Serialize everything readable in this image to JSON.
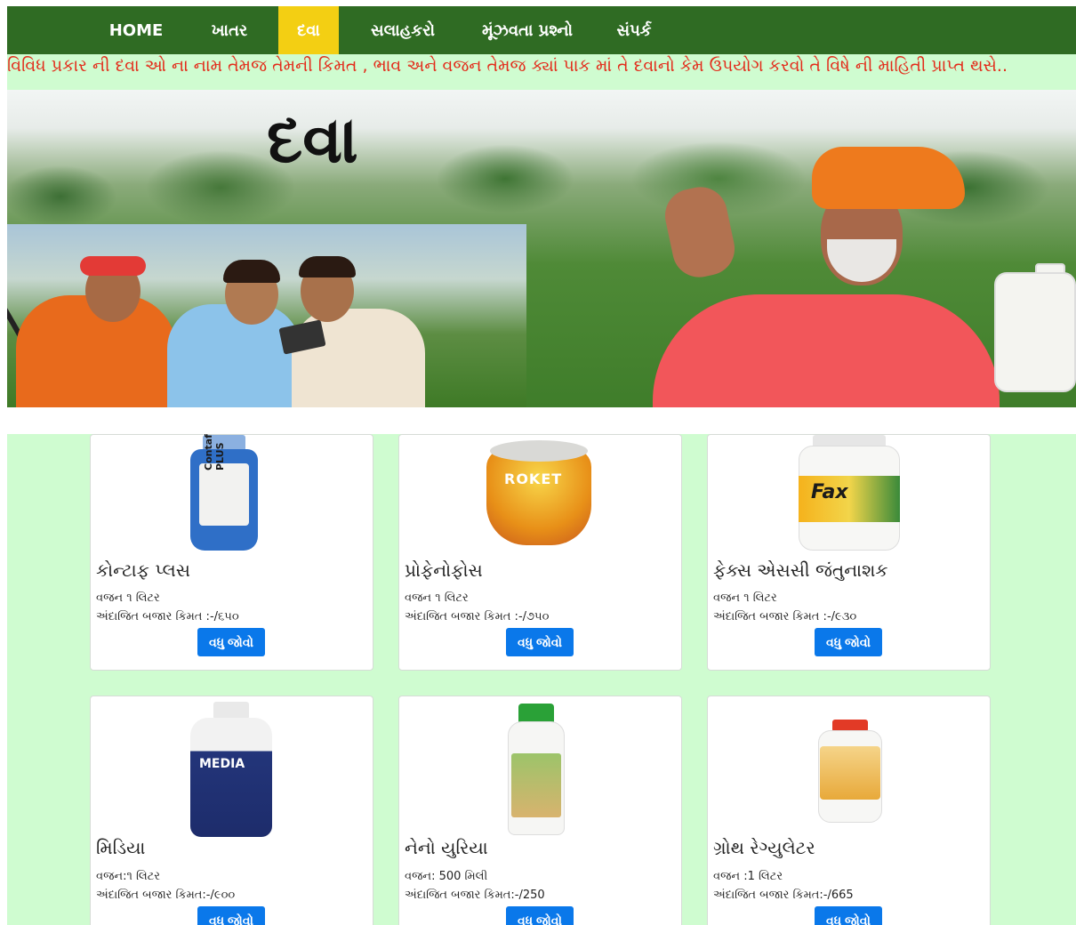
{
  "nav": {
    "items": [
      {
        "label": "HOME",
        "active": false
      },
      {
        "label": "ખાતર",
        "active": false
      },
      {
        "label": "દવા",
        "active": true
      },
      {
        "label": "સલાહકરો",
        "active": false
      },
      {
        "label": "મૂંઝવતા પ્રશ્નો",
        "active": false
      },
      {
        "label": "સંપર્ક",
        "active": false
      }
    ]
  },
  "marquee": {
    "text": "વિવિધ પ્રકાર ની દવા ઓ ના નામ તેમજ તેમની કિમત , ભાવ અને વજન તેમજ ક્યાં પાક માં તે દવાનો કેમ ઉપયોગ કરવો તે વિષે ની માહિતી પ્રાપ્ત થસે.."
  },
  "banner": {
    "title": "દવા"
  },
  "products": [
    {
      "name": "કોન્ટાફ પ્લસ",
      "weight": "વજન ૧ લિટર",
      "price": "અંદાજિત બજાર કિમત :-/૬૫૦",
      "button": "વધુ જોવો",
      "label": "Contaf PLUS"
    },
    {
      "name": "પ્રોફેનોફોસ",
      "weight": "વજન ૧ લિટર",
      "price": "અંદાજિત બજાર કિમત :-/૭૫૦",
      "button": "વધુ જોવો",
      "label": "ROKET"
    },
    {
      "name": "ફેક્સ એસસી જંતુનાશક",
      "weight": "વજન ૧ લિટર",
      "price": "અંદાજિત બજાર કિમત :-/૯૩૦",
      "button": "વધુ જોવો",
      "label": "Fax"
    },
    {
      "name": "મિડિયા",
      "weight": "વજન:૧ લિટર",
      "price": "અંદાજિત બજાર કિમત:-/૯૦૦",
      "button": "વધુ જોવો",
      "label": "MEDIA"
    },
    {
      "name": "નેનો યુરિયા",
      "weight": "વજન: 500 મિલી",
      "price": "અંદાજિત બજાર કિમત:-/250",
      "button": "વધુ જોવો",
      "label": ""
    },
    {
      "name": "ગ્રોથ રેગ્યુલેટર",
      "weight": "વજન :1 લિટર",
      "price": "અંદાજિત બજાર કિમત:-/665",
      "button": "વધુ જોવો",
      "label": ""
    }
  ],
  "colors": {
    "nav_bg": "#2f6b23",
    "nav_active": "#f3cf13",
    "marquee_text": "#e32b1a",
    "page_bg": "#cffcd0",
    "button": "#0a78ea"
  }
}
